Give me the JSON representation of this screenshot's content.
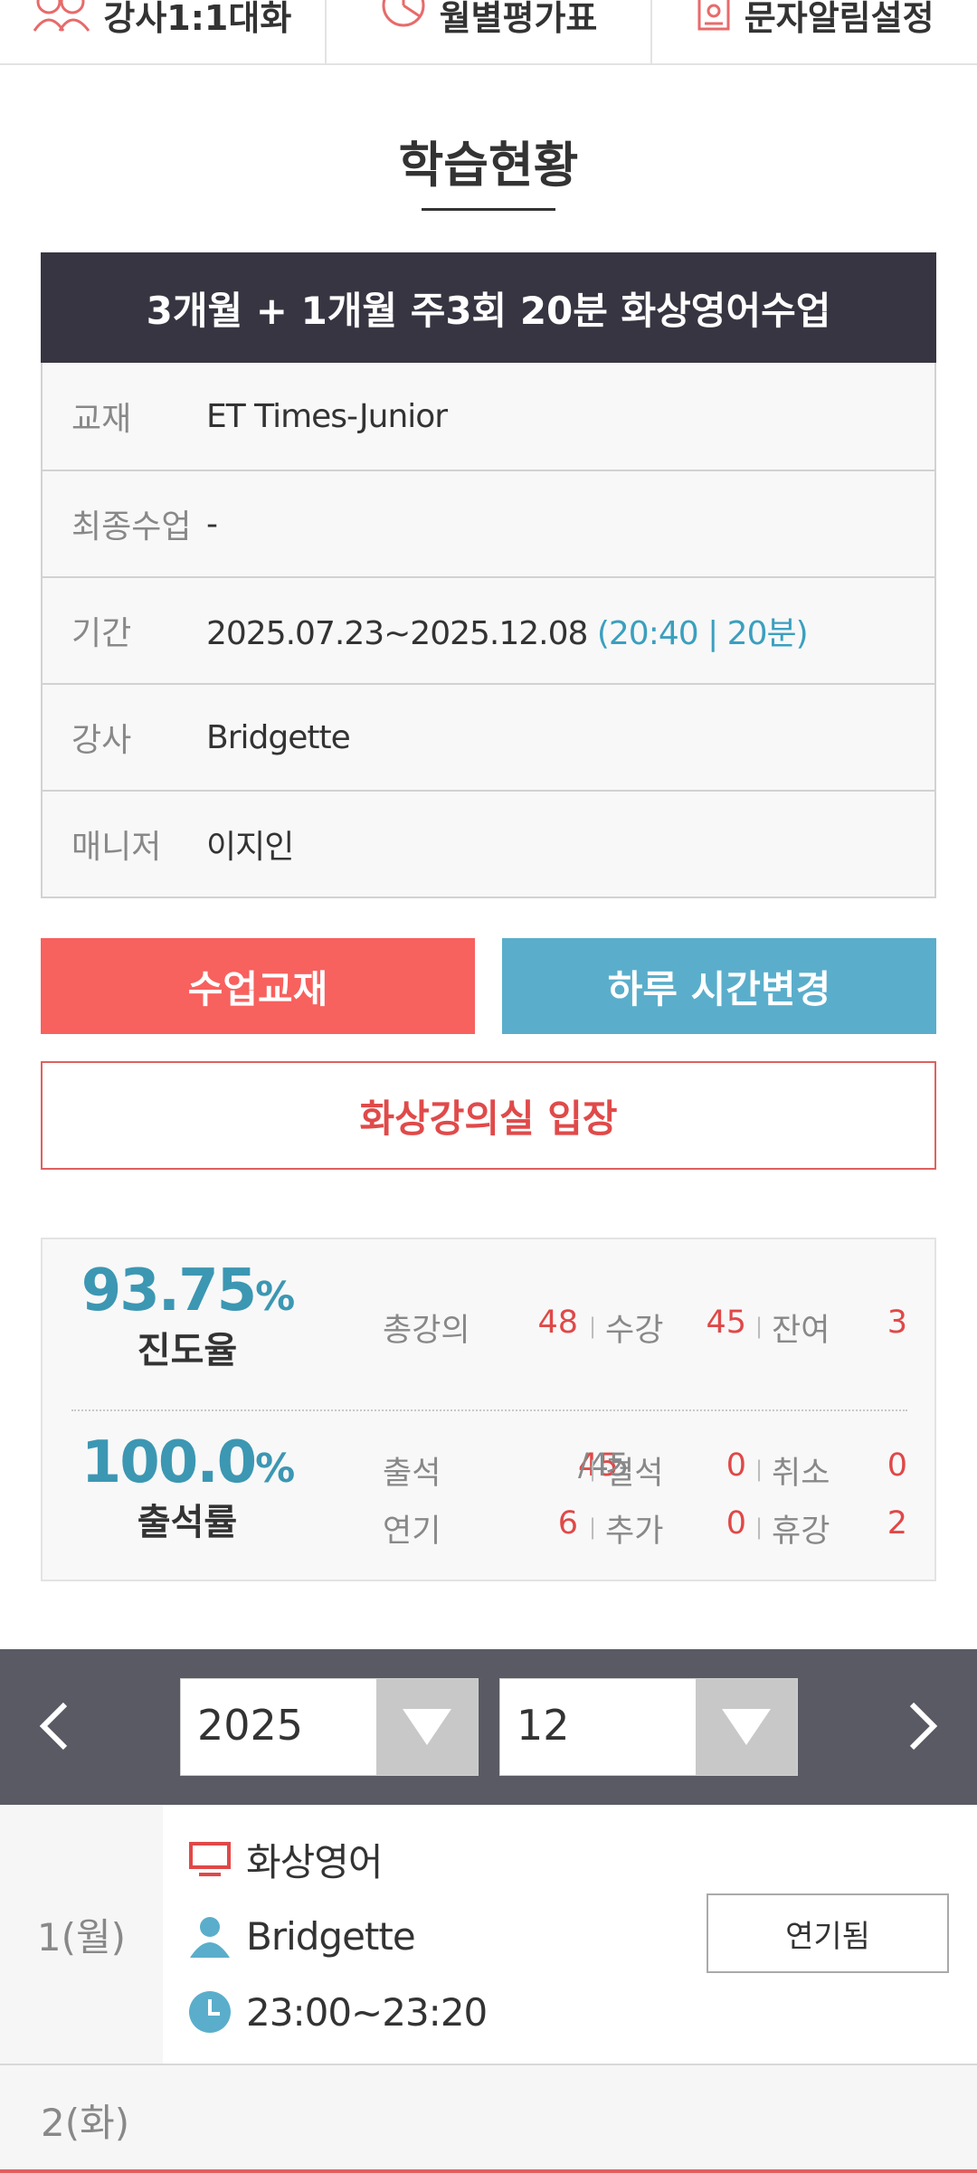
{
  "topnav": {
    "items": [
      {
        "label": "강사1:1대화",
        "icon": "people-icon"
      },
      {
        "label": "월별평가표",
        "icon": "chart-icon"
      },
      {
        "label": "문자알림설정",
        "icon": "message-icon"
      }
    ]
  },
  "page_title": "학습현황",
  "plan": {
    "title": "3개월 + 1개월 주3회 20분 화상영어수업",
    "rows": [
      {
        "label": "교재",
        "value": "ET Times-Junior",
        "extra": ""
      },
      {
        "label": "최종수업",
        "value": "-",
        "extra": ""
      },
      {
        "label": "기간",
        "value": "2025.07.23~2025.12.08",
        "extra": "(20:40 | 20분)"
      },
      {
        "label": "강사",
        "value": "Bridgette",
        "extra": ""
      },
      {
        "label": "매니저",
        "value": "이지인",
        "extra": ""
      }
    ]
  },
  "buttons": {
    "textbook": "수업교재",
    "change_time": "하루 시간변경",
    "enter_room": "화상강의실 입장"
  },
  "stats": {
    "progress": {
      "value": "93.75",
      "unit": "%",
      "caption": "진도율"
    },
    "attendance": {
      "value": "100.0",
      "unit": "%",
      "caption": "출석률"
    },
    "row1": [
      {
        "label": "총강의",
        "value": "48"
      },
      {
        "label": "수강",
        "value": "45"
      },
      {
        "label": "잔여",
        "value": "3"
      }
    ],
    "row2": [
      {
        "label": "출석",
        "value": "45",
        "total": "/45"
      },
      {
        "label": "결석",
        "value": "0"
      },
      {
        "label": "취소",
        "value": "0"
      }
    ],
    "row3": [
      {
        "label": "연기",
        "value": "6"
      },
      {
        "label": "추가",
        "value": "0"
      },
      {
        "label": "휴강",
        "value": "2"
      }
    ]
  },
  "calendar": {
    "year": "2025",
    "month": "12"
  },
  "schedule": [
    {
      "day": "1(월)",
      "type": "화상영어",
      "teacher": "Bridgette",
      "time": "23:00~23:20",
      "status": "연기됨"
    },
    {
      "day": "2(화)"
    }
  ],
  "colors": {
    "header_dark": "#363541",
    "accent_red": "#f7615e",
    "accent_blue": "#5aaecb",
    "stat_teal": "#3c97b3"
  }
}
